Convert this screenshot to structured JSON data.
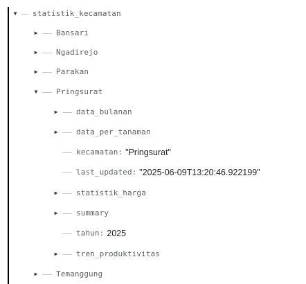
{
  "tree": {
    "root": {
      "key": "statistik_kecamatan",
      "expanded": true
    },
    "nodes": [
      {
        "key": "Bansari",
        "expanded": false
      },
      {
        "key": "Ngadirejo",
        "expanded": false
      },
      {
        "key": "Parakan",
        "expanded": false
      },
      {
        "key": "Pringsurat",
        "expanded": true,
        "children": [
          {
            "key": "data_bulanan",
            "expanded": false
          },
          {
            "key": "data_per_tanaman",
            "expanded": false
          },
          {
            "key": "kecamatan",
            "value": "\"Pringsurat\""
          },
          {
            "key": "last_updated",
            "value": "\"2025-06-09T13:20:46.922199\""
          },
          {
            "key": "statistik_harga",
            "expanded": false
          },
          {
            "key": "summary",
            "expanded": false
          },
          {
            "key": "tahun",
            "value": "2025"
          },
          {
            "key": "tren_produktivitas",
            "expanded": false
          }
        ]
      },
      {
        "key": "Temanggung",
        "expanded": false
      }
    ]
  },
  "icons": {
    "collapsed": "caret-right-icon",
    "expanded": "caret-down-icon"
  },
  "colors": {
    "key": "#5f6368",
    "value": "#202124",
    "rail": "#000000",
    "connector": "#c5c5c5"
  }
}
